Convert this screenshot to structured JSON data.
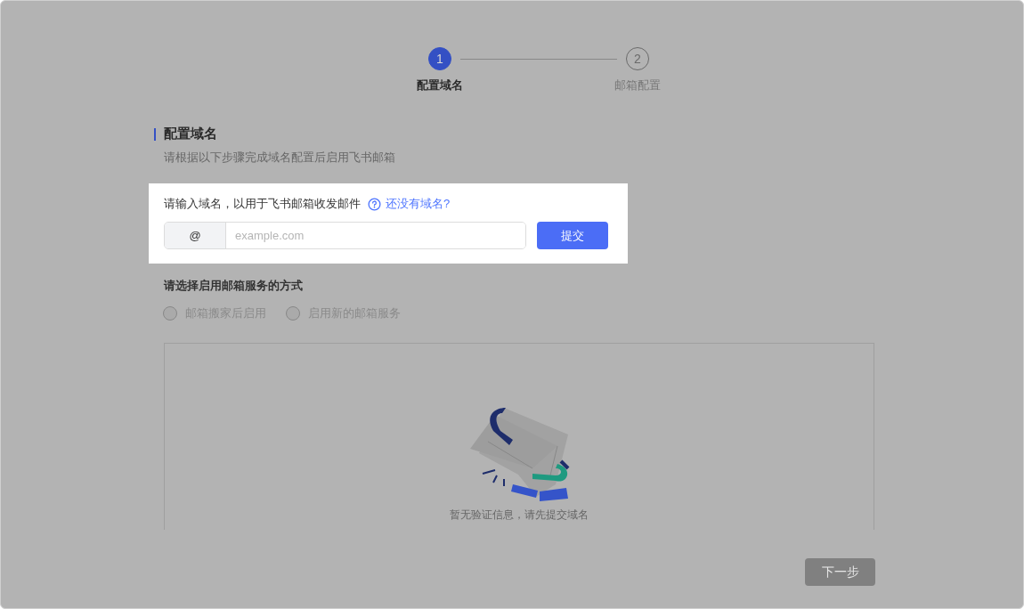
{
  "steps": [
    {
      "number": "1",
      "label": "配置域名",
      "selected": true
    },
    {
      "number": "2",
      "label": "邮箱配置",
      "selected": false
    }
  ],
  "section": {
    "title": "配置域名",
    "subtitle": "请根据以下步骤完成域名配置后启用飞书邮箱"
  },
  "domain_card": {
    "prompt": "请输入域名，以用于飞书邮箱收发邮件",
    "help_link": "还没有域名?",
    "prefix": "@",
    "placeholder": "example.com",
    "submit": "提交"
  },
  "service": {
    "title": "请选择启用邮箱服务的方式",
    "options": [
      {
        "label": "邮箱搬家后启用",
        "selected": false,
        "disabled": true
      },
      {
        "label": "启用新的邮箱服务",
        "selected": false,
        "disabled": true
      }
    ]
  },
  "empty_state": {
    "message": "暂无验证信息，请先提交域名"
  },
  "next_button": {
    "label": "下一步",
    "disabled": true
  }
}
